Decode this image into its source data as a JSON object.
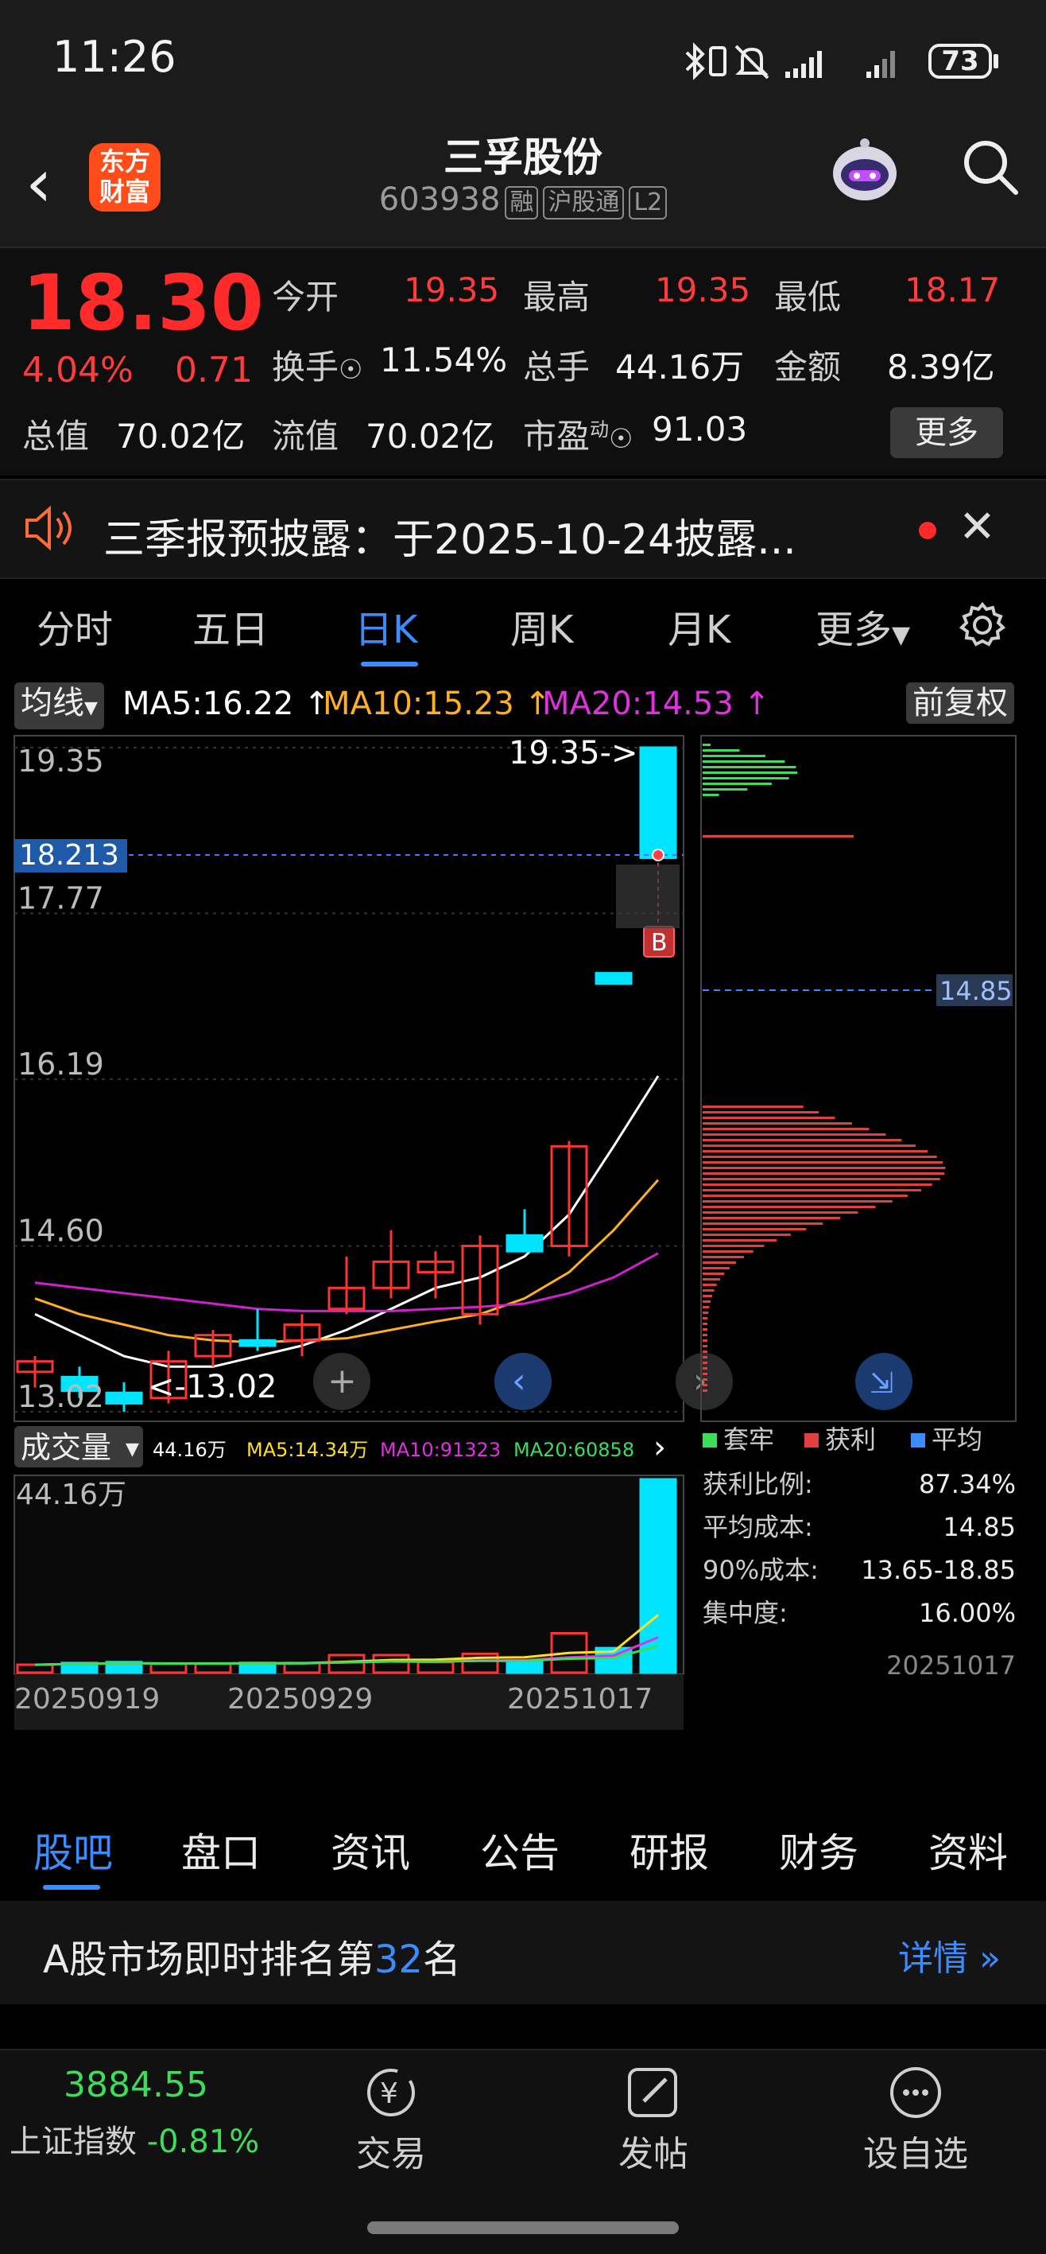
{
  "status_bar": {
    "time": "11:26",
    "battery": "73"
  },
  "header": {
    "logo_text": "东方\n财富",
    "title": "三孚股份",
    "code": "603938",
    "tags": [
      "融",
      "沪股通",
      "L2"
    ]
  },
  "quote": {
    "price": "18.30",
    "change_pct": "4.04%",
    "change": "0.71",
    "fields": [
      {
        "label": "今开",
        "value": "19.35",
        "color": "red"
      },
      {
        "label": "最高",
        "value": "19.35",
        "color": "red"
      },
      {
        "label": "最低",
        "value": "18.17",
        "color": "red"
      },
      {
        "label": "换手",
        "value": "11.54%",
        "color": "white"
      },
      {
        "label": "总手",
        "value": "44.16万",
        "color": "white"
      },
      {
        "label": "金额",
        "value": "8.39亿",
        "color": "white"
      },
      {
        "label": "总值",
        "value": "70.02亿",
        "color": "white"
      },
      {
        "label": "流值",
        "value": "70.02亿",
        "color": "white"
      },
      {
        "label": "市盈",
        "value": "91.03",
        "color": "white",
        "sup": "动"
      }
    ],
    "more_label": "更多"
  },
  "notice": {
    "text": "三季报预披露：于2025-10-24披露..."
  },
  "period_tabs": [
    "分时",
    "五日",
    "日K",
    "周K",
    "月K",
    "更多"
  ],
  "period_active": 2,
  "ma_row": {
    "indicator_label": "均线",
    "ma5": "MA5:16.22",
    "ma10": "MA10:15.23",
    "ma20": "MA20:14.53",
    "adjust_label": "前复权"
  },
  "colors": {
    "up": "#ff3333",
    "down": "#00e5ff",
    "ma5": "#ffffff",
    "ma10": "#ffb020",
    "ma20": "#d020d0",
    "chip_trapped": "#3ddc5a",
    "chip_profit": "#e04040",
    "chip_avg": "#3b8cff"
  },
  "chart_data": [
    {
      "type": "candlestick",
      "y_tick_labels": [
        "19.35",
        "17.77",
        "16.19",
        "14.60",
        "13.02"
      ],
      "ylim": [
        13.02,
        19.35
      ],
      "crosshair_price": "18.213",
      "high_annotation": "19.35->",
      "low_annotation": "<-13.02",
      "signal_label": "B",
      "candles": [
        {
          "o": 13.4,
          "h": 13.55,
          "l": 13.25,
          "c": 13.5
        },
        {
          "o": 13.35,
          "h": 13.45,
          "l": 13.15,
          "c": 13.22
        },
        {
          "o": 13.2,
          "h": 13.3,
          "l": 13.02,
          "c": 13.1
        },
        {
          "o": 13.15,
          "h": 13.6,
          "l": 13.1,
          "c": 13.5
        },
        {
          "o": 13.55,
          "h": 13.8,
          "l": 13.45,
          "c": 13.75
        },
        {
          "o": 13.7,
          "h": 14.0,
          "l": 13.6,
          "c": 13.65
        },
        {
          "o": 13.7,
          "h": 13.95,
          "l": 13.55,
          "c": 13.85
        },
        {
          "o": 14.0,
          "h": 14.5,
          "l": 13.95,
          "c": 14.2
        },
        {
          "o": 14.2,
          "h": 14.75,
          "l": 14.1,
          "c": 14.45
        },
        {
          "o": 14.35,
          "h": 14.55,
          "l": 14.1,
          "c": 14.45
        },
        {
          "o": 13.95,
          "h": 14.7,
          "l": 13.85,
          "c": 14.6
        },
        {
          "o": 14.7,
          "h": 14.95,
          "l": 14.55,
          "c": 14.55
        },
        {
          "o": 14.6,
          "h": 15.6,
          "l": 14.5,
          "c": 15.55
        },
        {
          "o": 17.2,
          "h": 17.2,
          "l": 17.1,
          "c": 17.1
        },
        {
          "o": 19.35,
          "h": 19.35,
          "l": 18.3,
          "c": 18.3
        }
      ],
      "ma5_line": [
        13.95,
        13.75,
        13.55,
        13.45,
        13.45,
        13.55,
        13.65,
        13.8,
        14.0,
        14.2,
        14.3,
        14.5,
        14.9,
        15.55,
        16.22
      ],
      "ma10_line": [
        14.1,
        13.95,
        13.85,
        13.75,
        13.7,
        13.68,
        13.7,
        13.72,
        13.8,
        13.88,
        13.95,
        14.1,
        14.35,
        14.75,
        15.23
      ],
      "ma20_line": [
        14.25,
        14.2,
        14.15,
        14.1,
        14.05,
        14.0,
        13.98,
        13.98,
        13.98,
        14.0,
        14.02,
        14.05,
        14.15,
        14.3,
        14.53
      ]
    },
    {
      "type": "bar",
      "volume_label": "成交量",
      "volume_value": "44.16万",
      "ma5": "MA5:14.34万",
      "ma10": "MA10:91323",
      "ma20": "MA20:60858",
      "y_max_label": "44.16万",
      "date_labels": [
        "20250919",
        "20250929",
        "20251017"
      ],
      "values": [
        1.8,
        2.2,
        2.4,
        2.0,
        2.0,
        2.2,
        2.2,
        4.0,
        4.0,
        2.4,
        4.3,
        2.8,
        9.0,
        5.6,
        44.16
      ],
      "ylim": [
        0,
        44.16
      ]
    },
    {
      "type": "chip-distribution",
      "legend": [
        "套牢",
        "获利",
        "平均"
      ],
      "avg_label": "14.85",
      "stats": [
        {
          "label": "获利比例:",
          "value": "87.34%"
        },
        {
          "label": "平均成本:",
          "value": "14.85"
        },
        {
          "label": "90%成本:",
          "value": "13.65-18.85"
        },
        {
          "label": "集中度:",
          "value": "16.00%"
        }
      ],
      "date": "20251017"
    }
  ],
  "bottom_tabs": [
    "股吧",
    "盘口",
    "资讯",
    "公告",
    "研报",
    "财务",
    "资料"
  ],
  "bottom_active": 0,
  "rank": {
    "prefix": "A股市场即时排名第",
    "number": "32",
    "suffix": "名",
    "more": "详情"
  },
  "footer": {
    "index_value": "3884.55",
    "index_name": "上证指数",
    "index_change": "-0.81%",
    "buttons": [
      "交易",
      "发帖",
      "设自选"
    ]
  }
}
